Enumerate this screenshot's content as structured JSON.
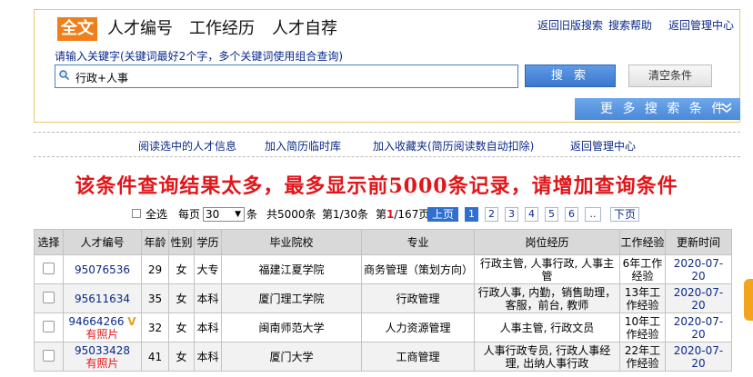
{
  "search": {
    "tabs": [
      "全文",
      "人才编号",
      "工作经历",
      "人才自荐"
    ],
    "hint": "请输入关键字(关键词最好2个字，多个关键词使用组合查询)",
    "value": "行政+人事",
    "search_button": "搜  索",
    "clear_button": "清空条件",
    "more_button": "更 多 搜 索 条 件",
    "top_links": [
      "返回旧版搜索",
      "搜索帮助",
      "返回管理中心"
    ]
  },
  "actions": [
    "阅读选中的人才信息",
    "加入简历临时库",
    "加入收藏夹(简历阅读数自动扣除)",
    "返回管理中心"
  ],
  "warning": "该条件查询结果太多，最多显示前5000条记录，请增加查询条件",
  "pager": {
    "select_all": "全选",
    "per_page_label": "每页",
    "per_page": "30",
    "per_page_unit": "条",
    "total": "共5000条",
    "page_of": "第1/30条",
    "page_prefix": "第",
    "current_page": "1",
    "total_pages": "/167页",
    "prev": "上页",
    "pages": [
      "1",
      "2",
      "3",
      "4",
      "5",
      "6",
      ".."
    ],
    "next": "下页"
  },
  "table": {
    "headers": [
      "选择",
      "人才编号",
      "年龄",
      "性别",
      "学历",
      "毕业院校",
      "专业",
      "岗位经历",
      "工作经验",
      "更新时间"
    ],
    "rows": [
      {
        "id": "95076536",
        "photo": "",
        "v": "",
        "age": "29",
        "gender": "女",
        "edu": "大专",
        "school": "福建江夏学院",
        "major": "商务管理（策划方向）",
        "exp": "行政主管, 人事行政, 人事主管",
        "years": "6年工作经验",
        "date": "2020-07-20"
      },
      {
        "id": "95611634",
        "photo": "",
        "v": "",
        "age": "35",
        "gender": "女",
        "edu": "本科",
        "school": "厦门理工学院",
        "major": "行政管理",
        "exp": "行政人事, 内勤，销售助理，客服，前台, 教师",
        "years": "13年工作经验",
        "date": "2020-07-20"
      },
      {
        "id": "94664266",
        "photo": "有照片",
        "v": "V",
        "age": "32",
        "gender": "女",
        "edu": "本科",
        "school": "闽南师范大学",
        "major": "人力资源管理",
        "exp": "人事主管, 行政文员",
        "years": "10年工作经验",
        "date": "2020-07-20"
      },
      {
        "id": "95033428",
        "photo": "有照片",
        "v": "",
        "age": "41",
        "gender": "女",
        "edu": "本科",
        "school": "厦门大学",
        "major": "工商管理",
        "exp": "人事行政专员, 行政人事经理, 出纳人事行政",
        "years": "22年工作经验",
        "date": "2020-07-20"
      }
    ]
  },
  "colors": {
    "accent": "#ef7f1a",
    "warning": "#e0161a",
    "link": "#0a2a8a",
    "button": "#3a78d0"
  }
}
